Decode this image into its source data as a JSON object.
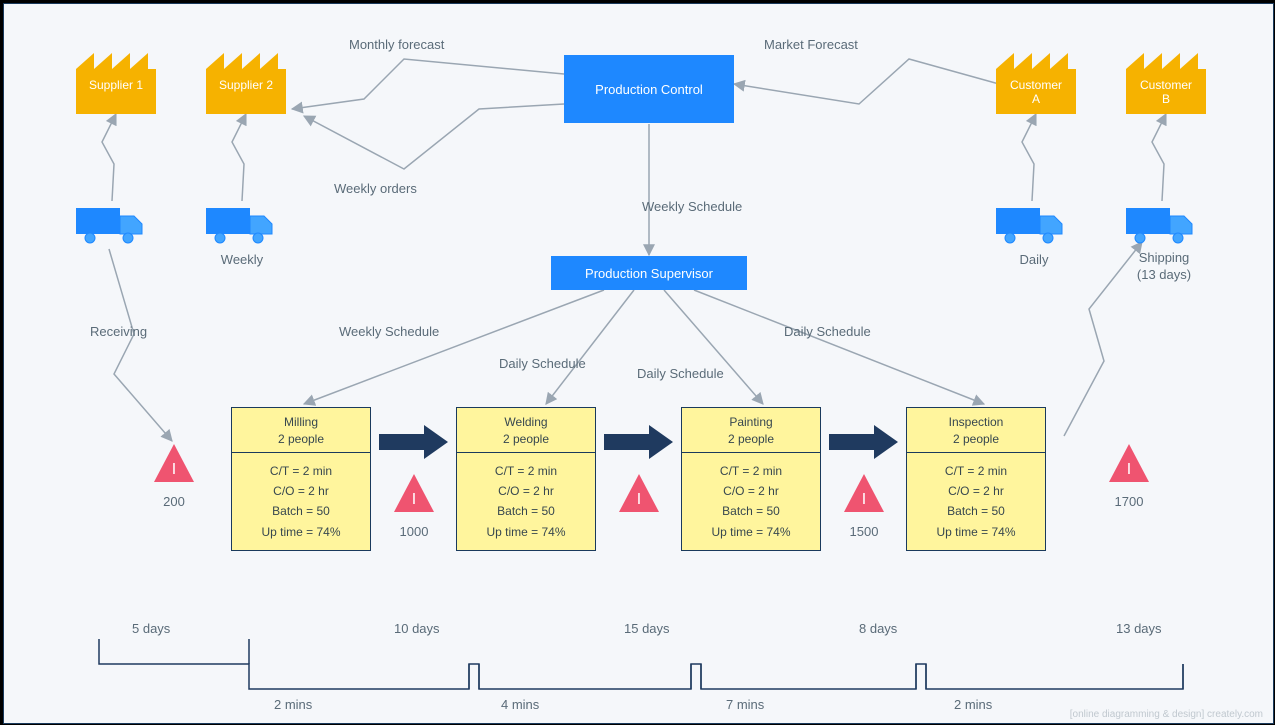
{
  "factories": {
    "supplier1": "Supplier 1",
    "supplier2": "Supplier 2",
    "customerA": "Customer\nA",
    "customerB": "Customer\nB"
  },
  "boxes": {
    "productionControl": "Production Control",
    "productionSupervisor": "Production Supervisor"
  },
  "trucks": {
    "supplier2": "Weekly",
    "customerA": "Daily",
    "customerB": "Shipping\n(13 days)"
  },
  "flowLabels": {
    "monthlyForecast": "Monthly forecast",
    "marketForecast": "Market Forecast",
    "weeklyOrders": "Weekly orders",
    "weeklySchedule": "Weekly Schedule",
    "receiving": "Receiving",
    "weeklyScheduleL": "Weekly Schedule",
    "dailyScheduleL": "Daily Schedule",
    "dailyScheduleM": "Daily Schedule",
    "dailyScheduleR": "Daily Schedule"
  },
  "processes": [
    {
      "name": "Milling",
      "people": "2 people",
      "ct": "C/T = 2 min",
      "co": "C/O = 2 hr",
      "batch": "Batch = 50",
      "uptime": "Up time = 74%"
    },
    {
      "name": "Welding",
      "people": "2 people",
      "ct": "C/T = 2 min",
      "co": "C/O = 2 hr",
      "batch": "Batch = 50",
      "uptime": "Up time = 74%"
    },
    {
      "name": "Painting",
      "people": "2 people",
      "ct": "C/T = 2 min",
      "co": "C/O = 2 hr",
      "batch": "Batch = 50",
      "uptime": "Up time = 74%"
    },
    {
      "name": "Inspection",
      "people": "2 people",
      "ct": "C/T = 2 min",
      "co": "C/O = 2 hr",
      "batch": "Batch = 50",
      "uptime": "Up time = 74%"
    }
  ],
  "inventory": {
    "i0": "200",
    "i1": "1000",
    "i2": "",
    "i3": "1500",
    "i4": "1700"
  },
  "inventoryGlyph": "I",
  "timeline": {
    "top": [
      "5 days",
      "10 days",
      "15 days",
      "8 days",
      "13 days"
    ],
    "bottom": [
      "2 mins",
      "4 mins",
      "7 mins",
      "2 mins"
    ]
  },
  "watermark": "[online diagramming & design]  creately.com"
}
